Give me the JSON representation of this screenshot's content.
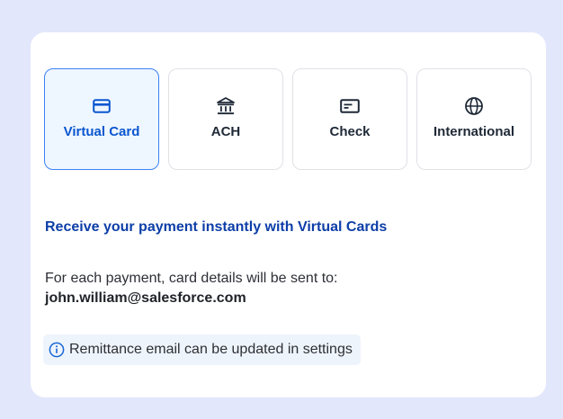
{
  "payment_methods": [
    {
      "label": "Virtual Card",
      "icon": "credit-card-icon",
      "selected": true
    },
    {
      "label": "ACH",
      "icon": "bank-icon",
      "selected": false
    },
    {
      "label": "Check",
      "icon": "check-icon",
      "selected": false
    },
    {
      "label": "International",
      "icon": "globe-icon",
      "selected": false
    }
  ],
  "headline": "Receive your payment instantly with Virtual Cards",
  "description": "For each payment, card details will be sent to:",
  "email": "john.william@salesforce.com",
  "notice": {
    "icon": "info-icon",
    "text": "Remittance email can be updated in settings"
  },
  "colors": {
    "background": "#e3e7fb",
    "accent": "#0b57d0",
    "headline": "#0d3ea8",
    "selected_border": "#3b82f6",
    "selected_fill": "#eef6ff",
    "notice_fill": "#eef4fb"
  }
}
